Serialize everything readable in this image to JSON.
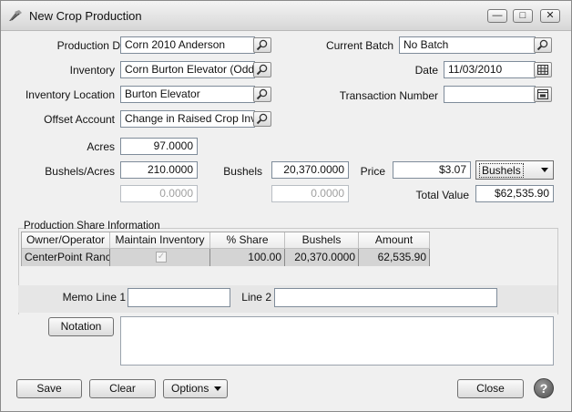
{
  "window": {
    "title": "New Crop Production",
    "controls": {
      "minimize": "—",
      "maximize": "□",
      "close": "✕"
    }
  },
  "form": {
    "production_detail": {
      "label": "Production Detail",
      "value": "Corn 2010 Anderson"
    },
    "inventory": {
      "label": "Inventory",
      "value": "Corn Burton Elevator (Odd)"
    },
    "inventory_location": {
      "label": "Inventory Location",
      "value": "Burton Elevator"
    },
    "offset_account": {
      "label": "Offset Account",
      "value": "Change in Raised Crop Inv"
    },
    "current_batch": {
      "label": "Current Batch",
      "value": "No Batch"
    },
    "date": {
      "label": "Date",
      "value": "11/03/2010"
    },
    "transaction_number": {
      "label": "Transaction Number",
      "value": ""
    },
    "acres": {
      "label": "Acres",
      "value": "97.0000"
    },
    "bushels_per_acre": {
      "label": "Bushels/Acres",
      "value": "210.0000",
      "second_value": "0.0000"
    },
    "bushels": {
      "label": "Bushels",
      "value": "20,370.0000",
      "second_value": "0.0000"
    },
    "price": {
      "label": "Price",
      "value": "$3.07",
      "unit": "Bushels"
    },
    "total_value": {
      "label": "Total Value",
      "value": "$62,535.90"
    }
  },
  "share": {
    "title": "Production Share Information",
    "columns": [
      "Owner/Operator",
      "Maintain Inventory",
      "% Share",
      "Bushels",
      "Amount"
    ],
    "rows": [
      {
        "owner": "CenterPoint Ranc",
        "maintain": "✓",
        "share": "100.00",
        "bushels": "20,370.0000",
        "amount": "62,535.90"
      }
    ]
  },
  "memo": {
    "line1_label": "Memo Line 1",
    "line1_value": "",
    "line2_label": "Line 2",
    "line2_value": ""
  },
  "buttons": {
    "notation": "Notation",
    "save": "Save",
    "clear": "Clear",
    "options": "Options",
    "close": "Close",
    "help": "?"
  },
  "icons": {
    "lookup": "magnifier-icon",
    "calendar": "calendar-icon",
    "picker": "list-picker-icon"
  }
}
